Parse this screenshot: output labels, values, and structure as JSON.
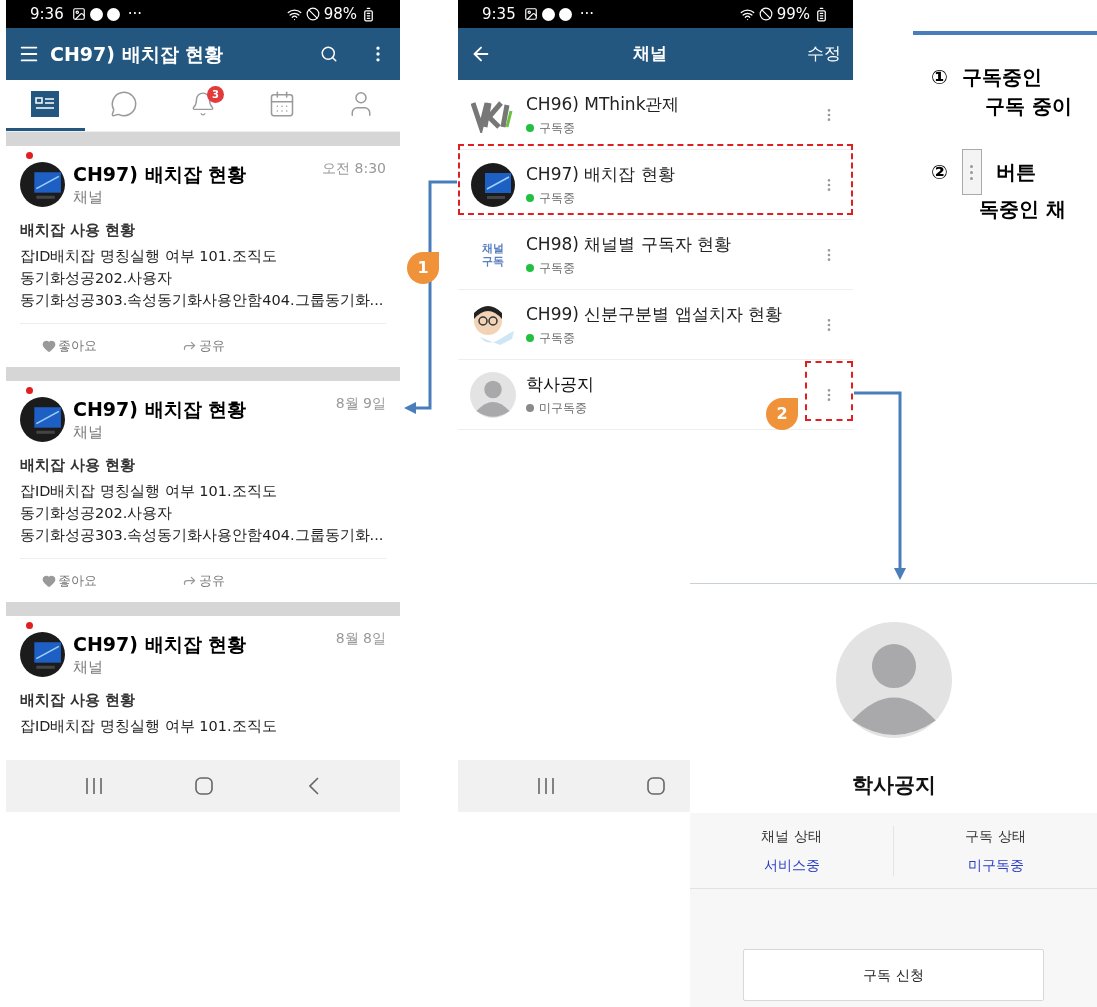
{
  "feed_screen": {
    "status_bar": {
      "time": "9:36",
      "more": "···",
      "battery": "98%"
    },
    "app_bar": {
      "title": "CH97) 배치잡 현황"
    },
    "tabs": [
      {
        "kind": "feed",
        "selected": true
      },
      {
        "kind": "chat",
        "selected": false
      },
      {
        "kind": "bell",
        "selected": false,
        "badge": "3"
      },
      {
        "kind": "calendar",
        "selected": false
      },
      {
        "kind": "person",
        "selected": false
      }
    ],
    "posts": [
      {
        "unread": true,
        "channel": "CH97) 배치잡 현황",
        "subtitle": "채널",
        "date": "오전 8:30",
        "heading": "배치잡 사용 현황",
        "lines": [
          "잡ID배치잡 명칭실행 여부 101.조직도",
          "동기화성공202.사용자",
          "동기화성공303.속성동기화사용안함404.그룹동기화..."
        ],
        "actions": [
          "좋아요",
          "공유"
        ]
      },
      {
        "unread": true,
        "channel": "CH97) 배치잡 현황",
        "subtitle": "채널",
        "date": "8월 9일",
        "heading": "배치잡 사용 현황",
        "lines": [
          "잡ID배치잡 명칭실행 여부 101.조직도",
          "동기화성공202.사용자",
          "동기화성공303.속성동기화사용안함404.그룹동기화..."
        ],
        "actions": [
          "좋아요",
          "공유"
        ]
      },
      {
        "unread": true,
        "channel": "CH97) 배치잡 현황",
        "subtitle": "채널",
        "date": "8월 8일",
        "heading": "배치잡 사용 현황",
        "lines": [
          "잡ID배치잡 명칭실행 여부 101.조직도"
        ]
      }
    ]
  },
  "channel_screen": {
    "status_bar": {
      "time": "9:35",
      "more": "···",
      "battery": "99%"
    },
    "app_bar": {
      "title": "채널",
      "action": "수정"
    },
    "channels": [
      {
        "kind": "logo",
        "name": "CH96) MThink관제",
        "status": "구독중",
        "subscribed": true,
        "highlighted": false
      },
      {
        "kind": "monitor",
        "name": "CH97) 배치잡 현황",
        "status": "구독중",
        "subscribed": true,
        "highlighted": true
      },
      {
        "kind": "text",
        "logo_text": [
          "채널",
          "구독"
        ],
        "name": "CH98) 채널별 구독자 현황",
        "status": "구독중",
        "subscribed": true,
        "highlighted": false
      },
      {
        "kind": "cartoon",
        "name": "CH99) 신분구분별 앱설치자 현황",
        "status": "구독중",
        "subscribed": true,
        "highlighted": false
      },
      {
        "kind": "default",
        "name": "학사공지",
        "status": "미구독중",
        "subscribed": false,
        "highlighted": false,
        "menu_highlighted": true
      }
    ]
  },
  "callouts": [
    "1",
    "2"
  ],
  "detail_screen": {
    "name": "학사공지",
    "stats": [
      {
        "label": "채널 상태",
        "value": "서비스중"
      },
      {
        "label": "구독 상태",
        "value": "미구독중"
      }
    ],
    "button": "구독 신청"
  },
  "notes": [
    {
      "number": "①",
      "lines": [
        "구독중인",
        "구독 중이"
      ]
    },
    {
      "number": "②",
      "lines": [
        "버튼",
        "독중인 채"
      ],
      "icon": true
    }
  ]
}
